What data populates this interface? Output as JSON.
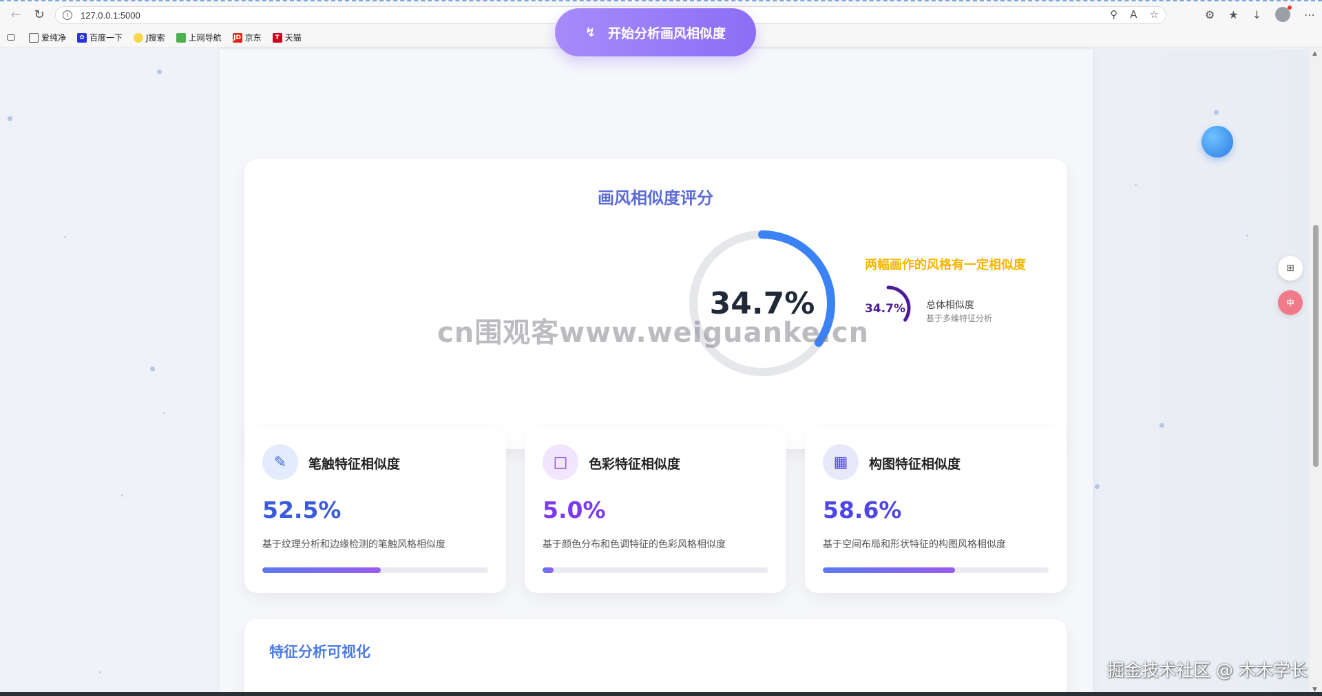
{
  "browser": {
    "url": "127.0.0.1:5000",
    "bookmarks": [
      "爱纯净",
      "百度一下",
      "J搜索",
      "上网导航",
      "京东",
      "天猫"
    ]
  },
  "actions": {
    "start_label": "开始分析画风相似度"
  },
  "score": {
    "title": "画风相似度评分",
    "overall_value": "34.7%",
    "overall_fraction": 0.347,
    "verdict": "两幅画作的风格有一定相似度",
    "mini_value": "34.7%",
    "total_label": "总体相似度",
    "total_sub": "基于多维特征分析"
  },
  "features": [
    {
      "name": "笔触特征相似度",
      "value": "52.5%",
      "fraction": 0.525,
      "desc": "基于纹理分析和边缘检测的笔触风格相似度",
      "color": "#3b5bdb",
      "icon": "pencil-icon"
    },
    {
      "name": "色彩特征相似度",
      "value": "5.0%",
      "fraction": 0.05,
      "desc": "基于颜色分布和色调特征的色彩风格相似度",
      "color": "#7c3aed",
      "icon": "palette-icon"
    },
    {
      "name": "构图特征相似度",
      "value": "58.6%",
      "fraction": 0.586,
      "desc": "基于空间布局和形状特征的构图风格相似度",
      "color": "#4f46e5",
      "icon": "layout-icon"
    }
  ],
  "visualization": {
    "title": "特征分析可视化"
  },
  "overlay": {
    "watermark": "cn围观客www.weiguanke.cn",
    "credit": "掘金技术社区 @ 木木学长"
  },
  "colors": {
    "accent": "#8b6ef5",
    "ring": "#3b82f6",
    "verdict": "#f5b400"
  }
}
